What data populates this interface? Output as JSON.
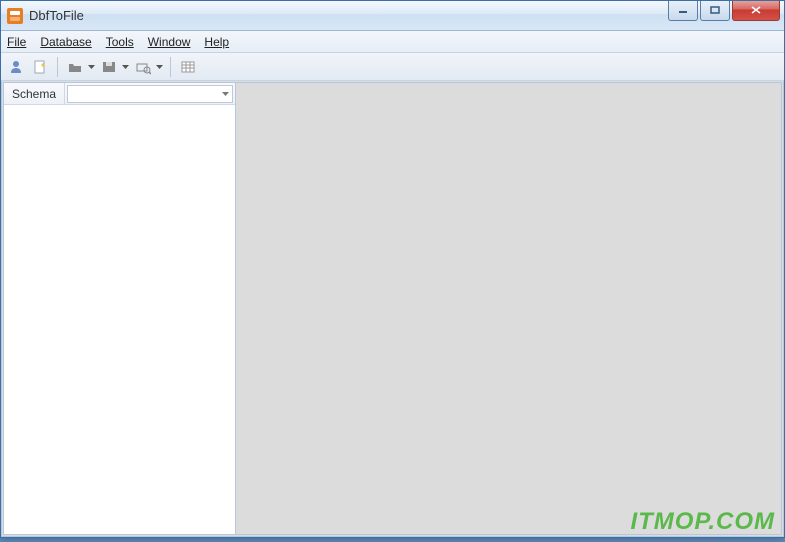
{
  "window": {
    "title": "DbfToFile"
  },
  "menu": {
    "file": "File",
    "database": "Database",
    "tools": "Tools",
    "window": "Window",
    "help": "Help"
  },
  "sidebar": {
    "schema_label": "Schema",
    "schema_value": ""
  },
  "watermark": "ITMOP.COM"
}
